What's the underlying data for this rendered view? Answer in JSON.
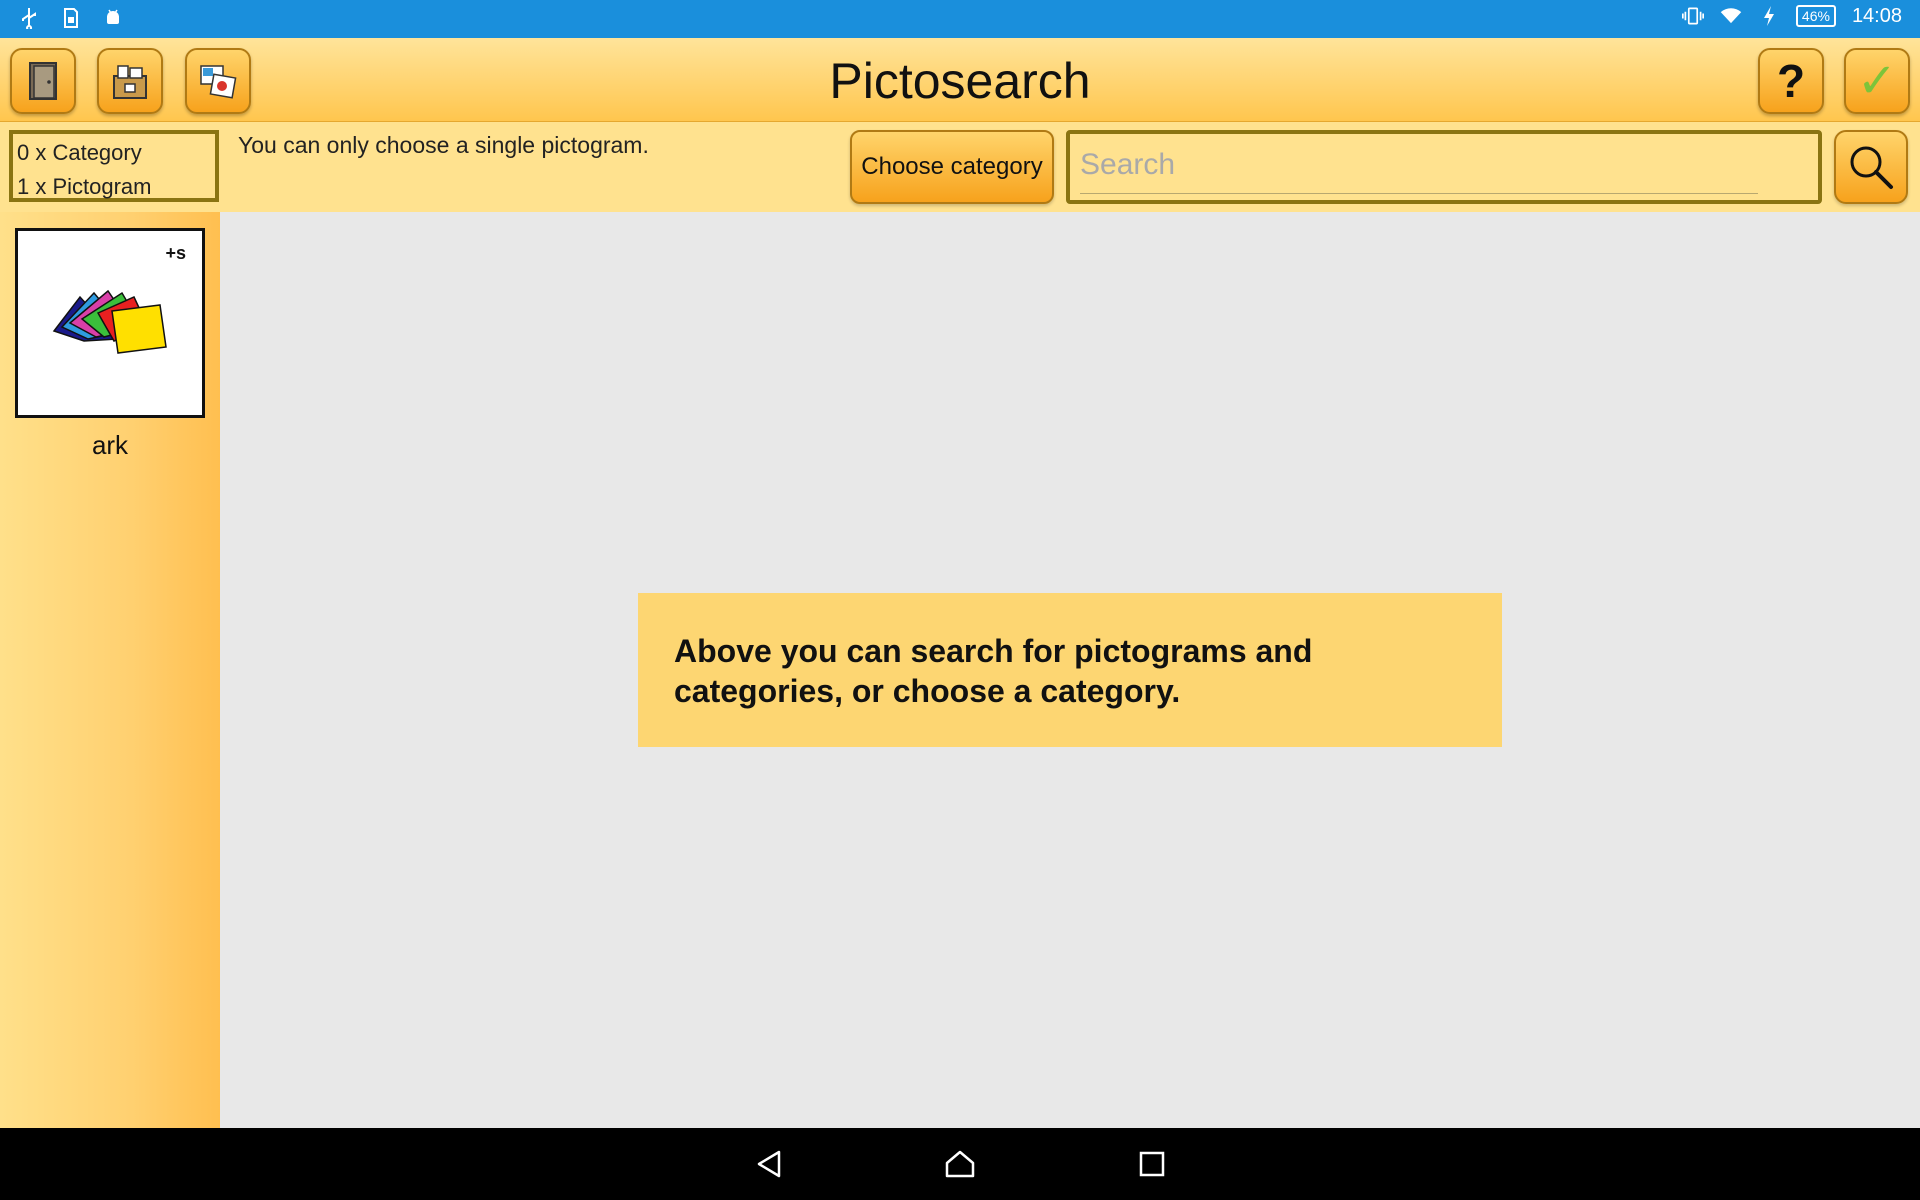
{
  "status_bar": {
    "left_icons": [
      "usb-icon",
      "sim-icon",
      "android-debug-icon"
    ],
    "right_icons": [
      "vibrate-icon",
      "wifi-icon",
      "charging-icon"
    ],
    "battery": "46%",
    "time": "14:08",
    "color": "#1a8fdc"
  },
  "title_bar": {
    "title": "Pictosearch",
    "left_buttons": [
      "exit-icon",
      "archive-icon",
      "photo-icon"
    ],
    "help_label": "?",
    "confirm_label": "✓"
  },
  "toolbar": {
    "category_count": "0 x Category",
    "pictogram_count": "1 x Pictogram",
    "hint": "You can only choose a single pictogram.",
    "choose_category_label": "Choose category",
    "search_placeholder": "Search",
    "search_value": ""
  },
  "sidebar": {
    "items": [
      {
        "label": "ark",
        "badge": "+s",
        "icon": "colored-papers-icon"
      }
    ]
  },
  "main": {
    "info": "Above you can search for pictograms and categories, or choose a category."
  },
  "nav_bar": {
    "buttons": [
      "back-icon",
      "home-icon",
      "recents-icon"
    ]
  }
}
